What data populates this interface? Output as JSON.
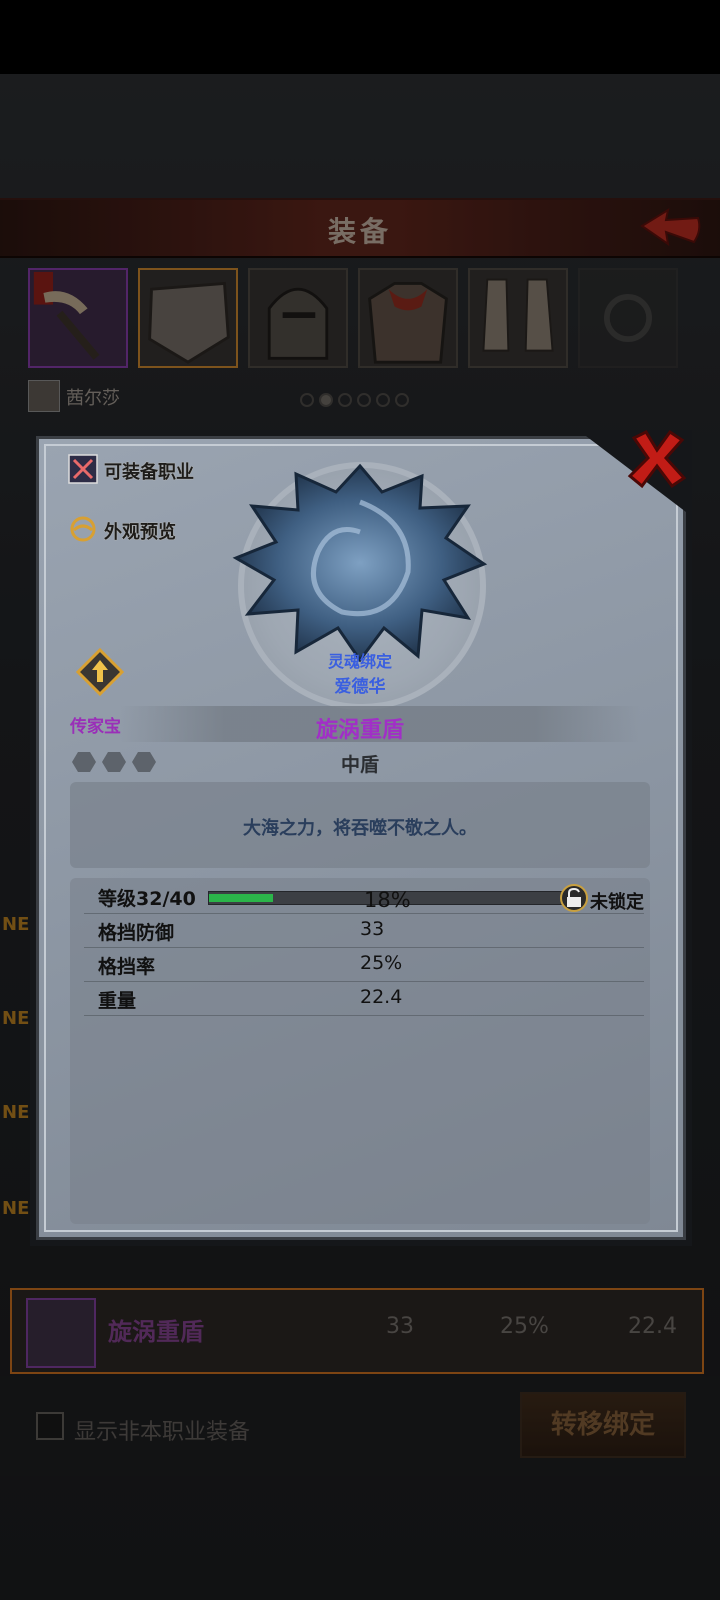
{
  "header": {
    "title": "装备"
  },
  "character": {
    "name": "茜尔莎"
  },
  "new_markers": [
    "NE",
    "NE",
    "NE",
    "NE"
  ],
  "bottom_item": {
    "name": "旋涡重盾",
    "block_defense": "33",
    "block_rate": "25%",
    "weight": "22.4"
  },
  "footer": {
    "checkbox_label": "显示非本职业装备",
    "transfer_button": "转移绑定"
  },
  "modal": {
    "options": {
      "equip_class": "可装备职业",
      "appearance_preview": "外观预览"
    },
    "soulbind_label": "灵魂绑定",
    "soulbind_owner": "爱德华",
    "rarity_label": "传家宝",
    "item_name": "旋涡重盾",
    "item_type": "中盾",
    "description": "大海之力，将吞噬不敬之人。",
    "level": {
      "label": "等级32/40",
      "progress_percent": 18,
      "progress_text": "18%",
      "lock_label": "未锁定"
    },
    "stats": [
      {
        "label": "格挡防御",
        "value": "33"
      },
      {
        "label": "格挡率",
        "value": "25%"
      },
      {
        "label": "重量",
        "value": "22.4"
      }
    ],
    "colors": {
      "item_name": "#a12fc7",
      "soulbind": "#3a5fe0",
      "progress": "#2bb54a"
    }
  }
}
